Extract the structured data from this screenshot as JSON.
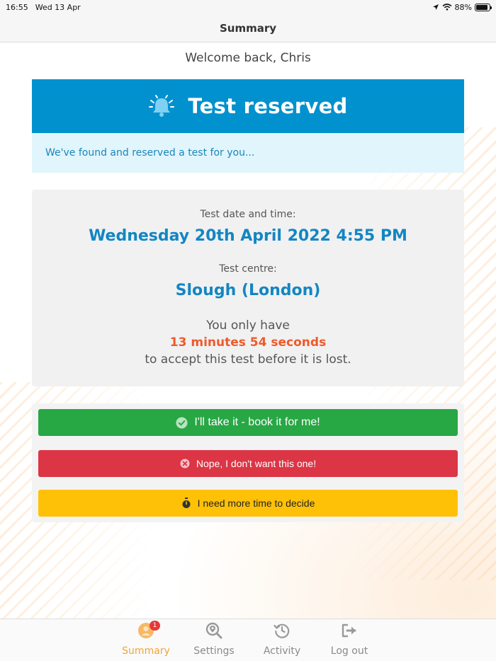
{
  "status_bar": {
    "time": "16:55",
    "date": "Wed 13 Apr",
    "battery": "88%",
    "battery_level": 0.88
  },
  "nav": {
    "title": "Summary"
  },
  "welcome": "Welcome back, Chris",
  "banner": {
    "title": "Test reserved",
    "subtitle": "We've found and reserved a test for you...",
    "icon": "bell-icon"
  },
  "details": {
    "date_label": "Test date and time:",
    "date_value": "Wednesday 20th April 2022 4:55 PM",
    "centre_label": "Test centre:",
    "centre_value": "Slough (London)",
    "only_have": "You only have",
    "countdown": "13 minutes 54 seconds",
    "accept_text": "to accept this test before it is lost."
  },
  "actions": {
    "accept": {
      "label": "I'll take it - book it for me!",
      "icon": "check-circle-icon"
    },
    "reject": {
      "label": "Nope, I don't want this one!",
      "icon": "x-circle-icon"
    },
    "more_time": {
      "label": "I need more time to decide",
      "icon": "stopwatch-icon"
    }
  },
  "tabs": [
    {
      "label": "Summary",
      "icon": "user-icon",
      "badge": "1",
      "active": true
    },
    {
      "label": "Settings",
      "icon": "search-pin-icon",
      "active": false
    },
    {
      "label": "Activity",
      "icon": "history-icon",
      "active": false
    },
    {
      "label": "Log out",
      "icon": "logout-icon",
      "active": false
    }
  ],
  "colors": {
    "brand_blue": "#0291cf",
    "accept_green": "#28a745",
    "reject_red": "#dc3545",
    "wait_yellow": "#ffc107",
    "countdown_orange": "#ef5a2a",
    "active_tab": "#f2a43a"
  }
}
